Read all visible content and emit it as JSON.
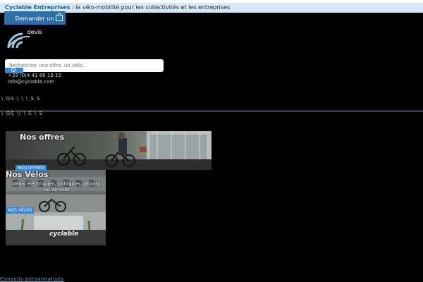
{
  "topbar": {
    "brand": "Cyclable Entreprises",
    "tagline": ": la vélo-mobilité pour les collectivités et les entreprises"
  },
  "header": {
    "quote_label": "Demander un devis",
    "search_placeholder": "Rechercher une offre, un vélo...",
    "phone": "+33 (0)4 41 66 19 15",
    "email": "info@cyclable.com"
  },
  "nav": {
    "row1": "\\ OS \\ \\ \\ S S",
    "row2": "\\ OS \\/ \\ S \\ S"
  },
  "tiles": {
    "offers": {
      "title": "Nos offres",
      "tag": "NOS OFFRES"
    },
    "bikes": {
      "title": "Nos Vélos",
      "subtitle": "Vélos électriques, utilitaires, pliants ou de ville",
      "tag": "NOS VÉLOS",
      "shop_sign": "cyclable"
    }
  },
  "footer": {
    "link": "Conseils personnalisés"
  },
  "colors": {
    "brand_blue": "#2e6fa6",
    "accent_blue": "#3d86c5",
    "topbar_bg": "#d6e8f5"
  }
}
